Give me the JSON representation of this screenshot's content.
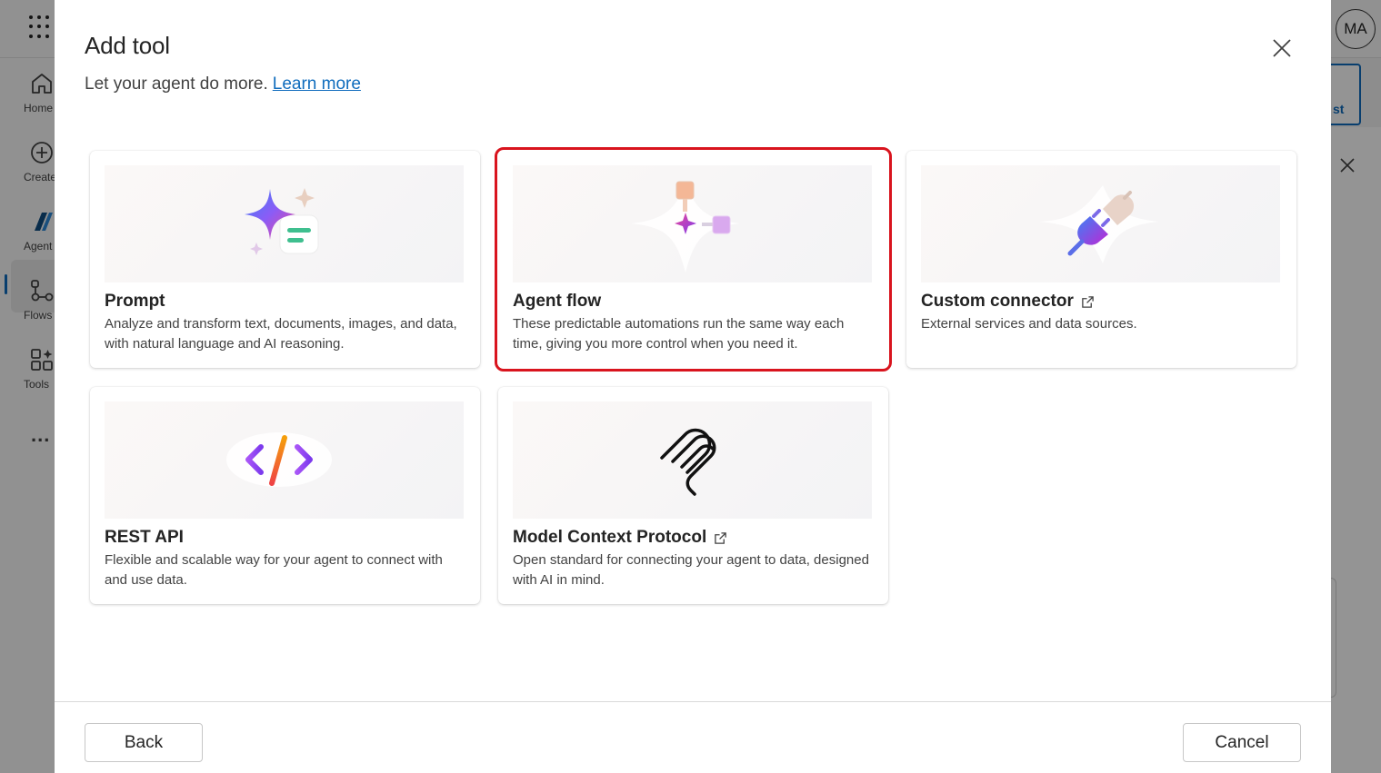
{
  "app": {
    "avatar_initials": "MA",
    "rail": [
      {
        "label": "Home",
        "icon": "home-icon"
      },
      {
        "label": "Create",
        "icon": "plus-circle-icon"
      },
      {
        "label": "Agent",
        "icon": "agent-logo-icon"
      },
      {
        "label": "Flows",
        "icon": "flow-icon"
      },
      {
        "label": "Tools",
        "icon": "tools-icon"
      }
    ],
    "rail_more": "...",
    "bg_button_fragment": "st"
  },
  "dialog": {
    "title": "Add tool",
    "subtitle": "Let your agent do more.",
    "learn_more": "Learn more",
    "cards": [
      {
        "title": "Prompt",
        "description": "Analyze and transform text, documents, images, and data, with natural language and AI reasoning.",
        "external": false,
        "selected": false
      },
      {
        "title": "Agent flow",
        "description": "These predictable automations run the same way each time, giving you more control when you need it.",
        "external": false,
        "selected": true
      },
      {
        "title": "Custom connector",
        "description": "External services and data sources.",
        "external": true,
        "selected": false
      },
      {
        "title": "REST API",
        "description": "Flexible and scalable way for your agent to connect with and use data.",
        "external": false,
        "selected": false
      },
      {
        "title": "Model Context Protocol",
        "description": "Open standard for connecting your agent to data, designed with AI in mind.",
        "external": true,
        "selected": false
      }
    ],
    "back_label": "Back",
    "cancel_label": "Cancel"
  },
  "colors": {
    "accent": "#0f6cbd",
    "selection_outline": "#d9141e"
  }
}
